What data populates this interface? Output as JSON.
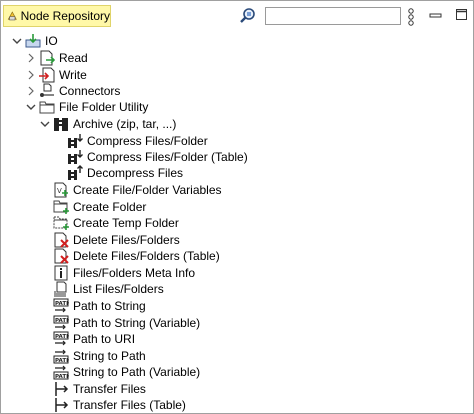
{
  "panel": {
    "title": "Node Repository",
    "search": {
      "value": "",
      "placeholder": ""
    }
  },
  "tree": {
    "root": {
      "label": "IO",
      "expanded": true
    },
    "io_children": [
      {
        "label": "Read",
        "icon": "read-node-icon"
      },
      {
        "label": "Write",
        "icon": "write-node-icon"
      },
      {
        "label": "Connectors",
        "icon": "connectors-icon"
      }
    ],
    "file_folder_utility": {
      "label": "File Folder Utility",
      "expanded": true,
      "archive": {
        "label": "Archive (zip, tar, ...)",
        "expanded": true,
        "items": [
          {
            "label": "Compress Files/Folder"
          },
          {
            "label": "Compress Files/Folder (Table)"
          },
          {
            "label": "Decompress Files"
          }
        ]
      },
      "items": [
        {
          "label": "Create File/Folder Variables",
          "icon": "create-variables-icon"
        },
        {
          "label": "Create Folder",
          "icon": "create-folder-icon"
        },
        {
          "label": "Create Temp Folder",
          "icon": "create-temp-folder-icon"
        },
        {
          "label": "Delete Files/Folders",
          "icon": "delete-files-icon"
        },
        {
          "label": "Delete Files/Folders (Table)",
          "icon": "delete-files-table-icon"
        },
        {
          "label": "Files/Folders Meta Info",
          "icon": "meta-info-icon"
        },
        {
          "label": "List Files/Folders",
          "icon": "list-files-icon"
        },
        {
          "label": "Path to String",
          "icon": "path-to-string-icon"
        },
        {
          "label": "Path to String (Variable)",
          "icon": "path-to-string-variable-icon"
        },
        {
          "label": "Path to URI",
          "icon": "path-to-uri-icon"
        },
        {
          "label": "String to Path",
          "icon": "string-to-path-icon"
        },
        {
          "label": "String to Path (Variable)",
          "icon": "string-to-path-variable-icon"
        },
        {
          "label": "Transfer Files",
          "icon": "transfer-files-icon"
        },
        {
          "label": "Transfer Files (Table)",
          "icon": "transfer-files-table-icon"
        }
      ]
    }
  },
  "colors": {
    "tab_bg": "#fff8a8",
    "accent": "#3c78c8",
    "red": "#d02020",
    "green": "#2a9a3a"
  }
}
